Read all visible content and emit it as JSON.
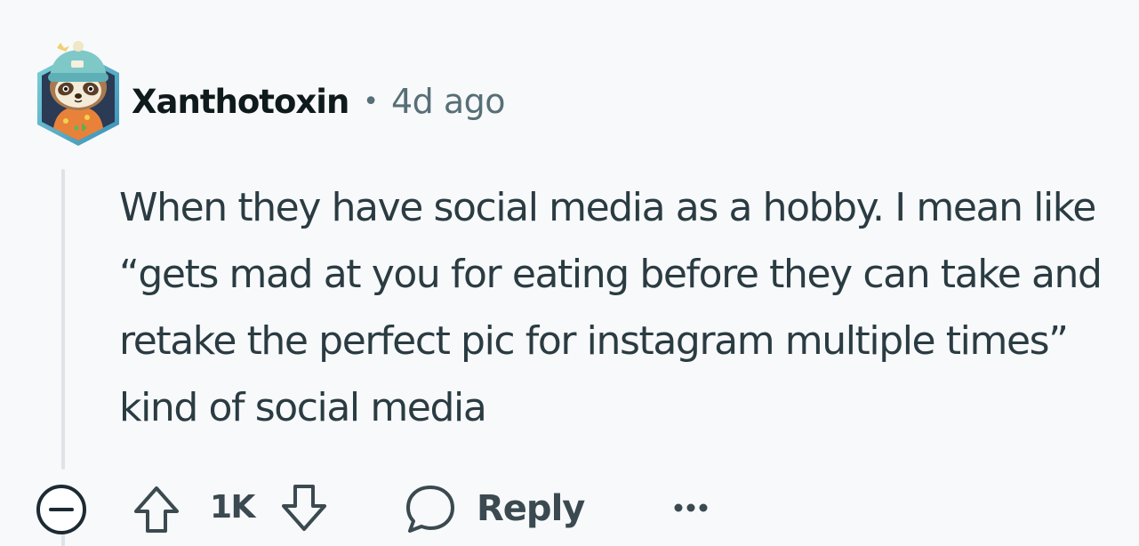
{
  "comment": {
    "author": "Xanthotoxin",
    "separator": "•",
    "timestamp": "4d ago",
    "body": "When they have social media as a hobby. I mean like “gets mad at you for eating before they can take and retake the perfect pic for instagram multiple times” kind of social media",
    "avatar_icon": "sloth-avatar-icon"
  },
  "actions": {
    "collapse_icon": "collapse-minus-icon",
    "upvote_icon": "upvote-arrow-icon",
    "vote_count": "1K",
    "downvote_icon": "downvote-arrow-icon",
    "reply_icon": "speech-bubble-icon",
    "reply_label": "Reply",
    "more_icon": "more-options-icon"
  },
  "colors": {
    "background": "#f8f9fb",
    "text": "#2a3c42",
    "muted": "#576f76",
    "thread_line": "#dfe3e8"
  }
}
